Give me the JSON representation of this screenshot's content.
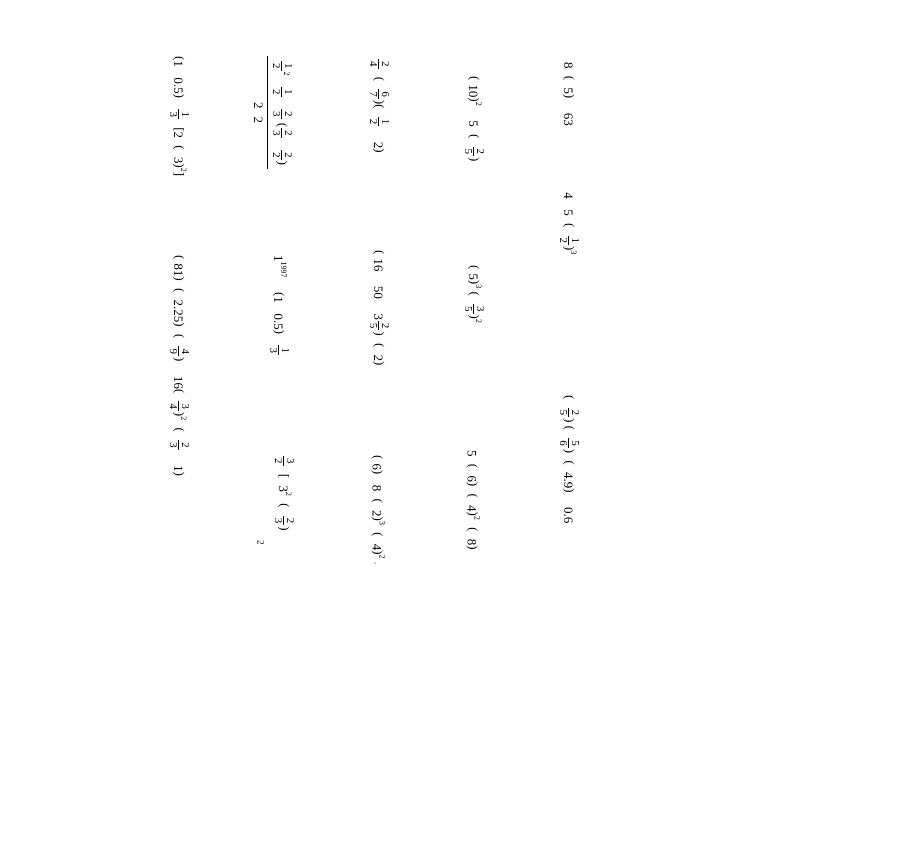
{
  "rows": {
    "r1l": {
      "a": "8",
      "b": "5",
      "c": "63",
      "m": "4",
      "n": "5",
      "fn": "1",
      "fd": "2",
      "p": "3"
    },
    "r1r": {
      "fn1": "2",
      "fd1": "5",
      "fn2": "5",
      "fd2": "6",
      "a": "4.9",
      "b": "0.6"
    },
    "r2l": {
      "a": "10",
      "p": "2",
      "b": "5",
      "fn": "2",
      "fd": "5"
    },
    "r2m": {
      "a": "5",
      "p1": "3",
      "fn": "3",
      "fd": "5",
      "p2": "2"
    },
    "r2r": {
      "a": "5",
      "b": "6",
      "c": "4",
      "p": "2",
      "d": "8"
    },
    "r3l": {
      "fn1": "2",
      "fd1": "4",
      "fn2": "6",
      "fd2": "7",
      "fn3": "1",
      "fd3": "2",
      "a": "2"
    },
    "r3m": {
      "a": "16",
      "b": "50",
      "mf_int": "3",
      "mf_n": "2",
      "mf_d": "5",
      "c": "2"
    },
    "r3r": {
      "a": "6",
      "b": "8",
      "c": "2",
      "p1": "3",
      "d": "4",
      "p2": "2"
    },
    "r4l": {
      "fn1": "1",
      "fd1": "2",
      "p": "2",
      "fn2": "1",
      "fd2": "2",
      "fn3": "2",
      "fd3": "3",
      "fn4": "2",
      "fd4": "3",
      "fn5": "2",
      "fd5": "2"
    },
    "r4m": {
      "a": "1",
      "p": "1997",
      "b": "1",
      "c": "0.5",
      "fn": "1",
      "fd": "3"
    },
    "r4r": {
      "fn": "3",
      "fd": "2",
      "a": "3",
      "p": "2",
      "fn2": "2",
      "fd2": "3",
      "foot": "2"
    },
    "r5l": {
      "a": "1",
      "b": "0.5",
      "fn": "1",
      "fd": "3",
      "c": "2",
      "d": "3",
      "p": "2"
    },
    "r5m": {
      "a": "81",
      "b": "2.25",
      "fn": "4",
      "fd": "9",
      "c": "16",
      "fn2": "3",
      "fd2": "4",
      "p": "2",
      "g": "2",
      "h": "3",
      "i": "1"
    }
  }
}
